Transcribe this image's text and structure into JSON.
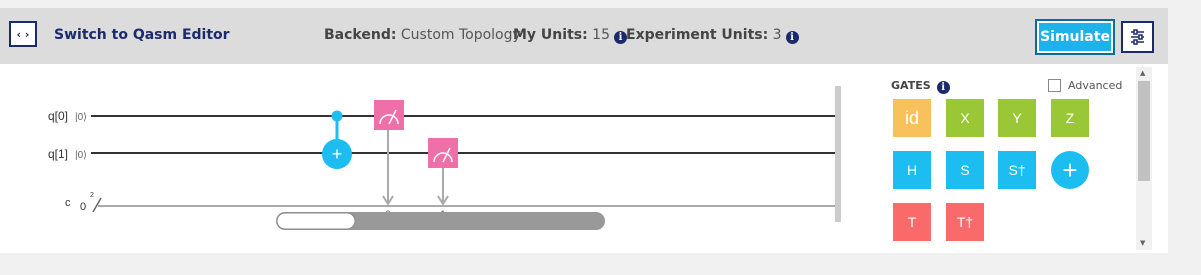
{
  "toolbar": {
    "toggle_label": "‹ ›",
    "switch_label": "Switch to Qasm Editor",
    "backend_label": "Backend:",
    "backend_value": "Custom Topology",
    "units_label": "My Units:",
    "units_value": "15",
    "exp_units_label": "Experiment Units:",
    "exp_units_value": "3",
    "info_glyph": "i",
    "simulate_label": "Simulate"
  },
  "circuit": {
    "qubit_labels": [
      "q[0]",
      "q[1]"
    ],
    "ket": "|0⟩",
    "classical_label": "c",
    "classical_init": "0",
    "classical_width": "2",
    "measure_targets": [
      "0",
      "1"
    ],
    "plus_glyph": "+"
  },
  "palette": {
    "title": "GATES",
    "advanced_label": "Advanced",
    "advanced_checked": false,
    "gates": [
      {
        "label": "id",
        "color": "#f9c15c"
      },
      {
        "label": "X",
        "color": "#9ac735"
      },
      {
        "label": "Y",
        "color": "#9ac735"
      },
      {
        "label": "Z",
        "color": "#9ac735"
      },
      {
        "label": "H",
        "color": "#1cbdf1"
      },
      {
        "label": "S",
        "color": "#1cbdf1"
      },
      {
        "label": "S†",
        "color": "#1cbdf1"
      },
      {
        "label": "+",
        "color": "#1cbdf1"
      },
      {
        "label": "T",
        "color": "#fb6a6b"
      },
      {
        "label": "T†",
        "color": "#fb6a6b"
      }
    ]
  },
  "colors": {
    "accent": "#1b2a6b",
    "measure": "#ef6fa9",
    "cnot": "#1cbdf1"
  },
  "scroll": {
    "horizontal_position": 0.25
  }
}
